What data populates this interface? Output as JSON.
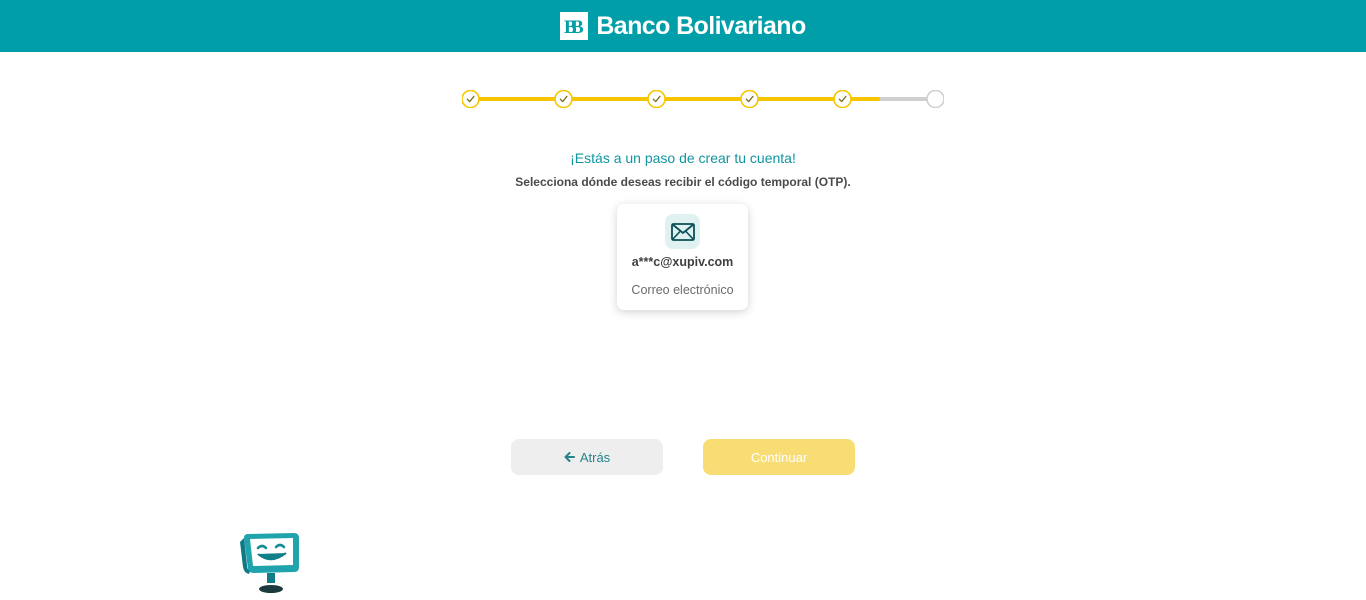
{
  "header": {
    "brand_name": "Banco Bolivariano",
    "logo_icon": "banco-bolivariano-logo-icon",
    "background_color": "#009ea8"
  },
  "stepper": {
    "total_steps": 6,
    "completed_steps": 5,
    "progress_fraction": 0.88,
    "active_color": "#f6c500",
    "inactive_color": "#cfcfcf",
    "completed_icon": "check-icon"
  },
  "main": {
    "heading": "¡Estás a un paso de crear tu cuenta!",
    "subheading": "Selecciona dónde deseas recibir el código temporal (OTP).",
    "option": {
      "icon": "envelope-icon",
      "value": "a***c@xupiv.com",
      "type_label": "Correo electrónico"
    }
  },
  "actions": {
    "back_label": "Atrás",
    "back_icon": "arrow-left-icon",
    "continue_label": "Continuar"
  },
  "assistant": {
    "icon": "chatbot-assistant-icon"
  }
}
